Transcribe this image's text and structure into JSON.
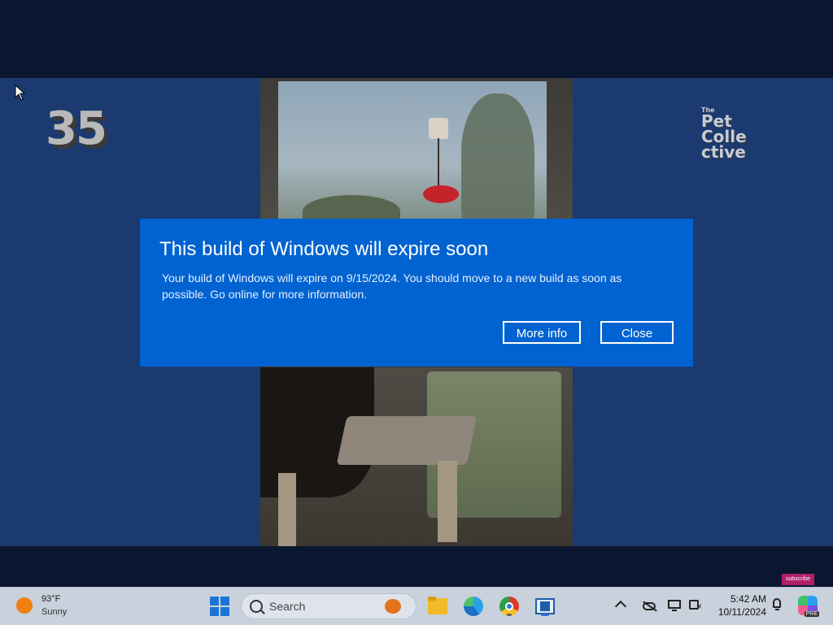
{
  "video": {
    "channel_number": "35",
    "logo_line1": "The",
    "logo_line2": "Pet",
    "logo_line3": "Colle",
    "logo_line4": "ctive",
    "subscribe_label": "subscribe"
  },
  "dialog": {
    "title": "This build of Windows will expire soon",
    "message": "Your build of Windows will expire on 9/15/2024. You should move to a new build as soon as possible. Go online for more information.",
    "more_info_label": "More info",
    "close_label": "Close",
    "background_color": "#0063d1"
  },
  "taskbar": {
    "weather": {
      "temperature": "93°F",
      "condition": "Sunny",
      "icon": "sun-icon"
    },
    "search_label": "Search",
    "apps": [
      {
        "name": "File Explorer",
        "icon": "folder-icon"
      },
      {
        "name": "Microsoft Edge",
        "icon": "edge-icon"
      },
      {
        "name": "Google Chrome",
        "icon": "chrome-icon"
      },
      {
        "name": "App",
        "icon": "app-icon"
      }
    ],
    "clock": {
      "time": "5:42 AM",
      "date": "10/11/2024"
    },
    "copilot_badge": "PRE"
  }
}
